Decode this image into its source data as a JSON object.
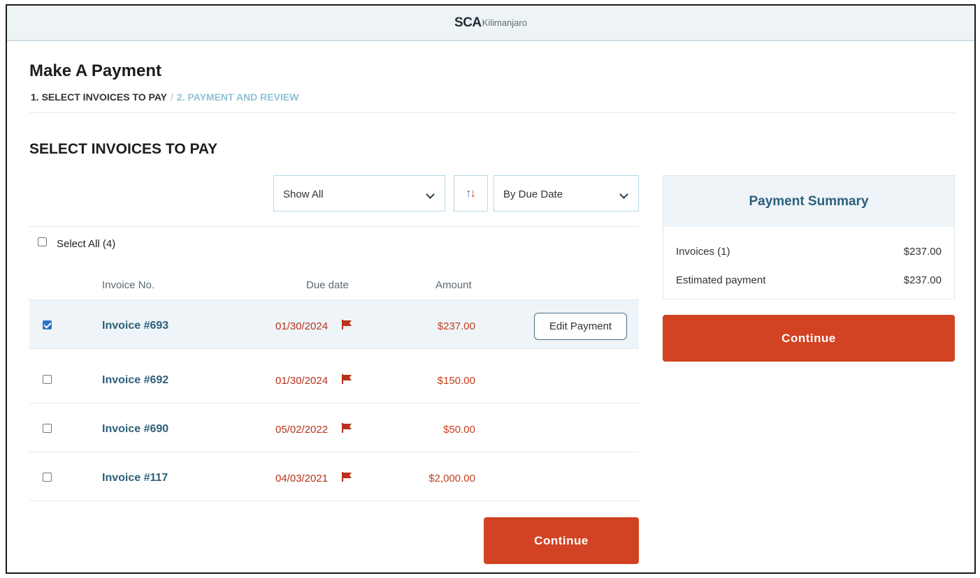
{
  "header": {
    "brand_main": "SCA",
    "brand_sub": "Kilimanjaro"
  },
  "page": {
    "title": "Make A Payment",
    "steps": [
      {
        "label": "1. SELECT INVOICES TO PAY",
        "active": true
      },
      {
        "label": "2. PAYMENT AND REVIEW",
        "active": false
      }
    ],
    "step_separator": "/"
  },
  "section_title": "SELECT INVOICES TO PAY",
  "filters": {
    "show": {
      "selected": "Show All"
    },
    "sort_icon": "sort-arrows-icon",
    "sort_by": {
      "selected": "By Due Date"
    }
  },
  "select_all": {
    "label": "Select All (4)",
    "checked": false
  },
  "columns": {
    "invoice_no": "Invoice No.",
    "due_date": "Due date",
    "amount": "Amount"
  },
  "invoices": [
    {
      "number": "Invoice #693",
      "due": "01/30/2024",
      "amount": "$237.00",
      "checked": true,
      "action": "Edit Payment",
      "overdue": true
    },
    {
      "number": "Invoice #692",
      "due": "01/30/2024",
      "amount": "$150.00",
      "checked": false,
      "overdue": true
    },
    {
      "number": "Invoice #690",
      "due": "05/02/2022",
      "amount": "$50.00",
      "checked": false,
      "overdue": true
    },
    {
      "number": "Invoice #117",
      "due": "04/03/2021",
      "amount": "$2,000.00",
      "checked": false,
      "overdue": true
    }
  ],
  "continue_label": "Continue",
  "summary": {
    "title": "Payment Summary",
    "rows": [
      {
        "label": "Invoices (1)",
        "value": "$237.00"
      },
      {
        "label": "Estimated payment",
        "value": "$237.00"
      }
    ],
    "continue_label": "Continue"
  },
  "colors": {
    "accent": "#d24323",
    "link": "#2d5f7a",
    "overdue": "#b8311b"
  }
}
